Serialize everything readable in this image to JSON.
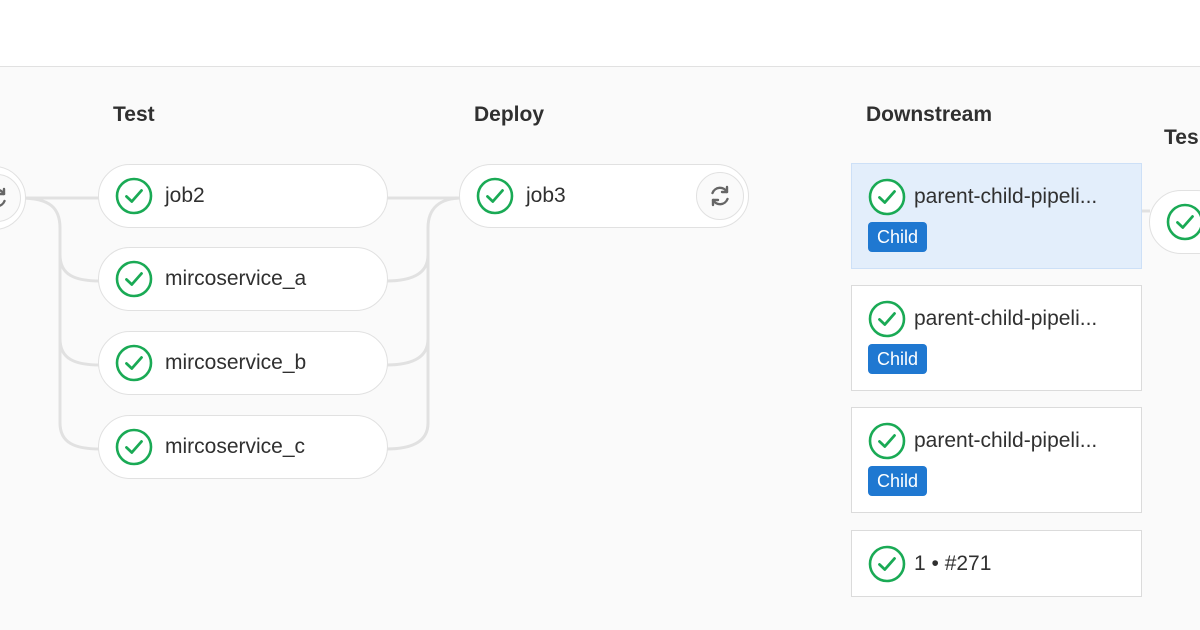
{
  "colors": {
    "success": "#1aaa55",
    "child_badge": "#1f78d1",
    "selected_card": "#e3eefb"
  },
  "stages": {
    "test": {
      "title": "Test",
      "jobs": [
        {
          "name": "job2",
          "status": "success",
          "icon": "status-success-icon"
        },
        {
          "name": "mircoservice_a",
          "status": "success",
          "icon": "status-success-icon"
        },
        {
          "name": "mircoservice_b",
          "status": "success",
          "icon": "status-success-icon"
        },
        {
          "name": "mircoservice_c",
          "status": "success",
          "icon": "status-success-icon"
        }
      ]
    },
    "deploy": {
      "title": "Deploy",
      "jobs": [
        {
          "name": "job3",
          "status": "success",
          "icon": "status-success-icon",
          "action_icon": "retry-icon"
        }
      ]
    },
    "downstream": {
      "title": "Downstream",
      "pipelines": [
        {
          "title": "parent-child-pipeli...",
          "badge": "Child",
          "status": "success",
          "selected": true
        },
        {
          "title": "parent-child-pipeli...",
          "badge": "Child",
          "status": "success",
          "selected": false
        },
        {
          "title": "parent-child-pipeli...",
          "badge": "Child",
          "status": "success",
          "selected": false
        },
        {
          "title": "1 • #271",
          "status": "success",
          "selected": false
        }
      ]
    },
    "next": {
      "title": "Tes"
    }
  },
  "previous_stage": {
    "action_icon": "retry-icon"
  }
}
